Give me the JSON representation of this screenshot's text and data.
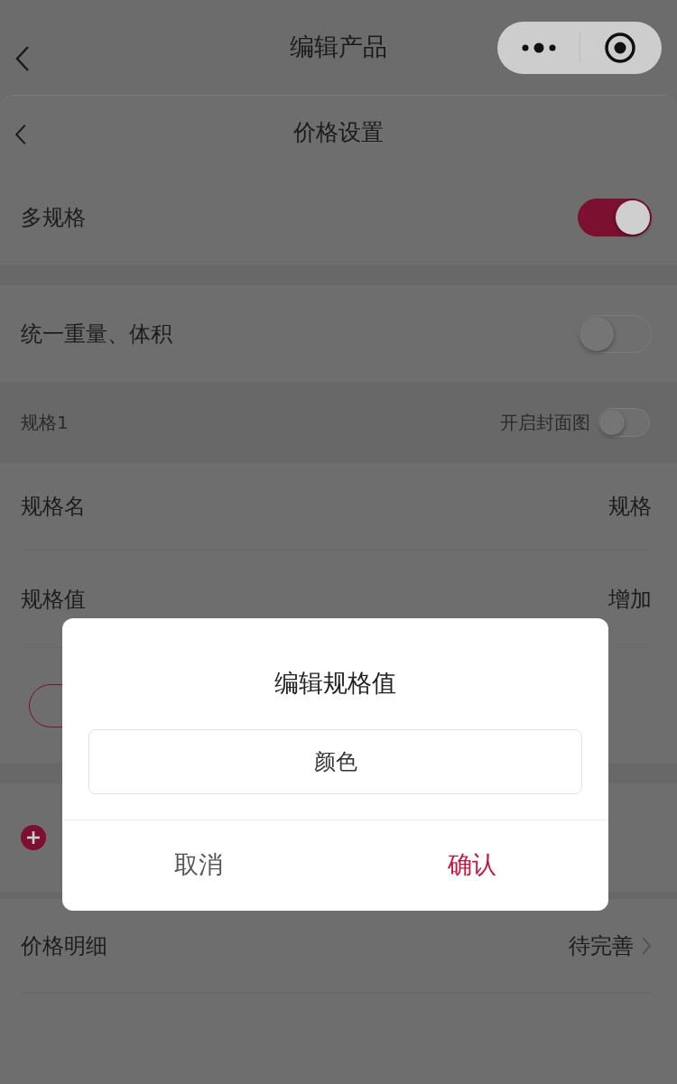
{
  "nav": {
    "title": "编辑产品"
  },
  "sheet": {
    "title": "价格设置"
  },
  "toggles": [
    {
      "label": "多规格",
      "on": true
    },
    {
      "label": "统一重量、体积",
      "on": false
    }
  ],
  "spec_group": {
    "title": "规格1",
    "cover_label": "开启封面图",
    "cover_on": false,
    "rows": [
      {
        "label": "规格名",
        "value": "规格"
      },
      {
        "label": "规格值",
        "value": "增加"
      }
    ]
  },
  "price_row": {
    "label": "价格明细",
    "value": "待完善"
  },
  "dialog": {
    "title": "编辑规格值",
    "input_value": "颜色",
    "buttons": [
      {
        "label": "取消",
        "kind": "cancel"
      },
      {
        "label": "确认",
        "kind": "confirm"
      }
    ]
  }
}
